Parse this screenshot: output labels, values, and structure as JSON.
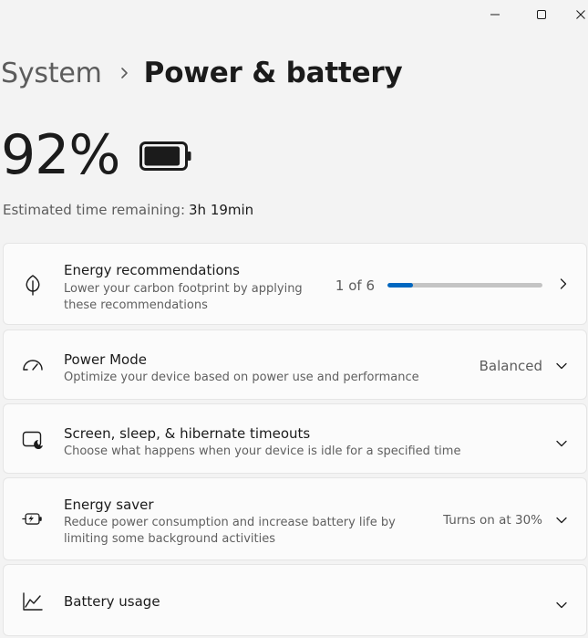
{
  "window": {
    "minimize_icon": "minimize-icon",
    "maximize_icon": "maximize-icon",
    "close_icon": "close-icon"
  },
  "breadcrumb": {
    "parent": "System",
    "current": "Power & battery"
  },
  "battery": {
    "percent_text": "92%",
    "level": 0.92,
    "estimated_label": "Estimated time remaining:",
    "estimated_value": "3h 19min"
  },
  "cards": {
    "energy_recommendations": {
      "title": "Energy recommendations",
      "description": "Lower your carbon footprint by applying these recommendations",
      "progress_text": "1 of 6",
      "progress_fraction": 0.1667,
      "icon": "leaf-icon"
    },
    "power_mode": {
      "title": "Power Mode",
      "description": "Optimize your device based on power use and performance",
      "value": "Balanced",
      "icon": "gauge-icon"
    },
    "screen_sleep": {
      "title": "Screen, sleep, & hibernate timeouts",
      "description": "Choose what happens when your device is idle for a specified time",
      "icon": "screen-sleep-icon"
    },
    "energy_saver": {
      "title": "Energy saver",
      "description": "Reduce power consumption and increase battery life by limiting some background activities",
      "value": "Turns on at 30%",
      "icon": "battery-saver-icon"
    },
    "battery_usage": {
      "title": "Battery usage",
      "icon": "line-chart-icon"
    }
  },
  "colors": {
    "accent": "#0067c0",
    "background": "#f3f3f3",
    "card": "#fbfbfb"
  }
}
